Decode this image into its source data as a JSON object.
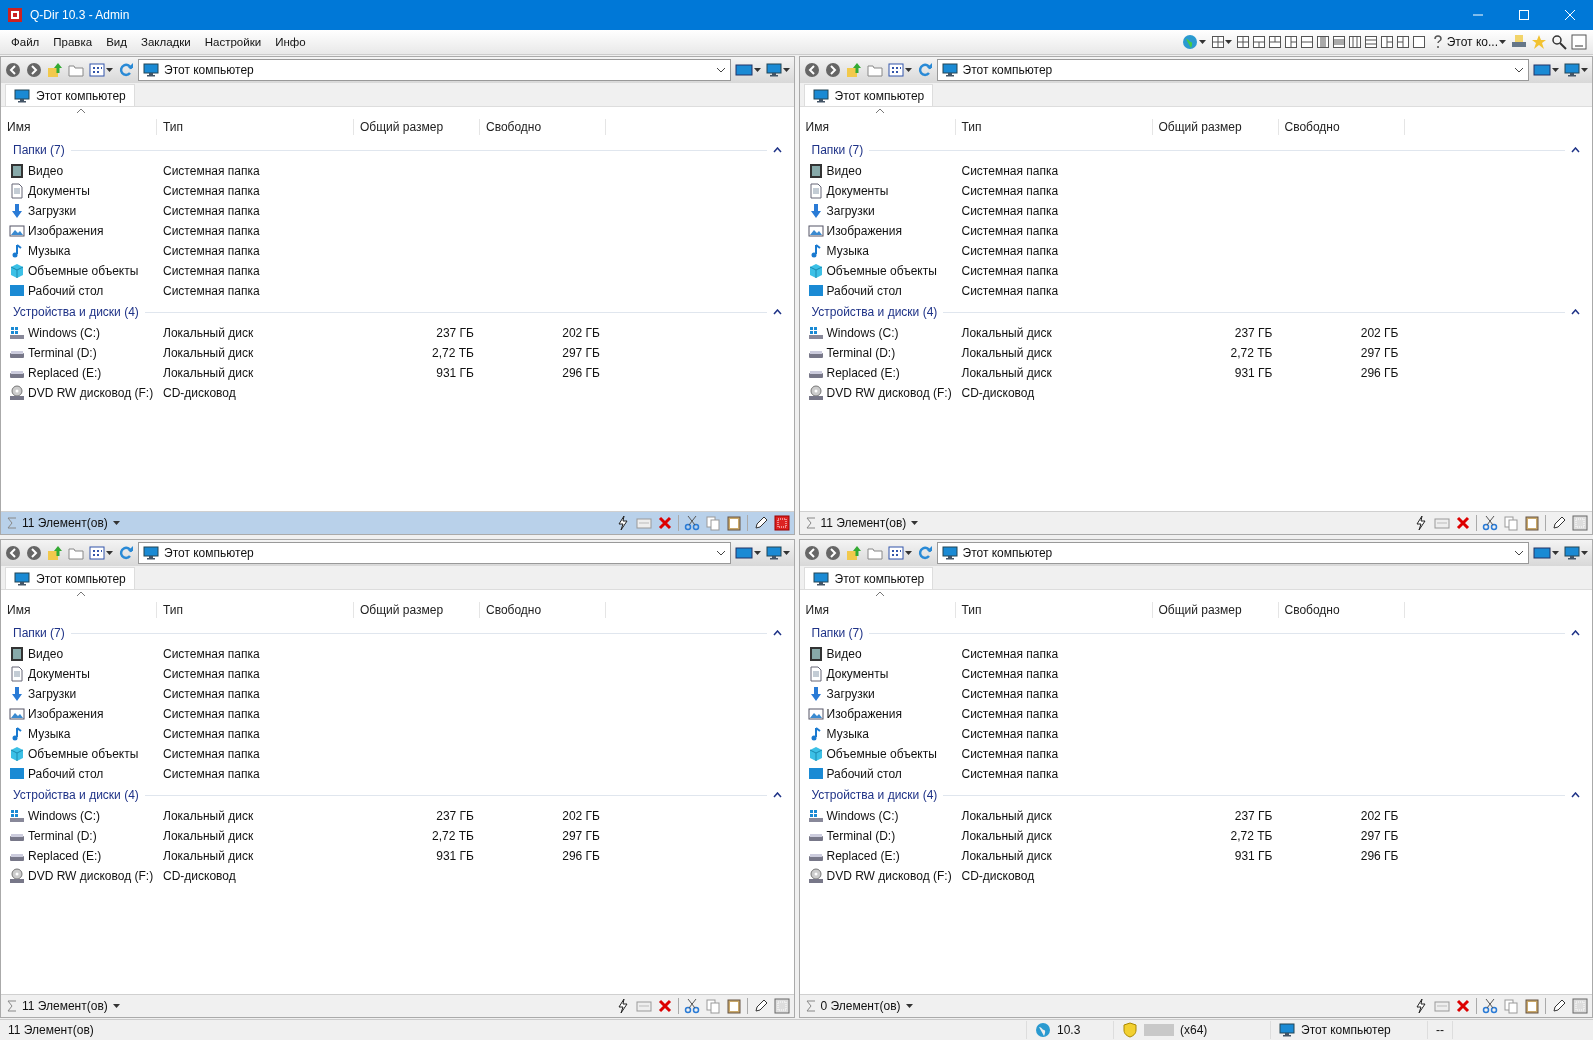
{
  "window": {
    "title": "Q-Dir 10.3 - Admin"
  },
  "menu": [
    "Файл",
    "Правка",
    "Вид",
    "Закладки",
    "Настройки",
    "Инфо"
  ],
  "toolbar": {
    "location": "Этот ко..."
  },
  "panes": [
    {
      "active": true,
      "address": "Этот компьютер",
      "tab": "Этот компьютер",
      "columns": [
        "Имя",
        "Тип",
        "Общий размер",
        "Свободно"
      ],
      "status": "11 Элемент(ов)",
      "groups": [
        {
          "title": "Папки (7)",
          "expanded": true,
          "items": [
            {
              "kind": "video",
              "name": "Видео",
              "type": "Системная папка"
            },
            {
              "kind": "documents",
              "name": "Документы",
              "type": "Системная папка"
            },
            {
              "kind": "downloads",
              "name": "Загрузки",
              "type": "Системная папка"
            },
            {
              "kind": "pictures",
              "name": "Изображения",
              "type": "Системная папка"
            },
            {
              "kind": "music",
              "name": "Музыка",
              "type": "Системная папка"
            },
            {
              "kind": "objects",
              "name": "Объемные объекты",
              "type": "Системная папка"
            },
            {
              "kind": "desktop",
              "name": "Рабочий стол",
              "type": "Системная папка"
            }
          ]
        },
        {
          "title": "Устройства и диски (4)",
          "expanded": true,
          "items": [
            {
              "kind": "system",
              "name": "Windows (C:)",
              "type": "Локальный диск",
              "total": "237 ГБ",
              "free": "202 ГБ"
            },
            {
              "kind": "drive",
              "name": "Terminal (D:)",
              "type": "Локальный диск",
              "total": "2,72 ТБ",
              "free": "297 ГБ"
            },
            {
              "kind": "drive",
              "name": "Replaced (E:)",
              "type": "Локальный диск",
              "total": "931 ГБ",
              "free": "296 ГБ"
            },
            {
              "kind": "dvd",
              "name": "DVD RW дисковод (F:)",
              "type": "CD-дисковод"
            }
          ]
        }
      ]
    },
    {
      "active": false,
      "address": "Этот компьютер",
      "tab": "Этот компьютер",
      "columns": [
        "Имя",
        "Тип",
        "Общий размер",
        "Свободно"
      ],
      "status": "11 Элемент(ов)",
      "groups": [
        {
          "title": "Папки (7)",
          "expanded": true,
          "items": [
            {
              "kind": "video",
              "name": "Видео",
              "type": "Системная папка"
            },
            {
              "kind": "documents",
              "name": "Документы",
              "type": "Системная папка"
            },
            {
              "kind": "downloads",
              "name": "Загрузки",
              "type": "Системная папка"
            },
            {
              "kind": "pictures",
              "name": "Изображения",
              "type": "Системная папка"
            },
            {
              "kind": "music",
              "name": "Музыка",
              "type": "Системная папка"
            },
            {
              "kind": "objects",
              "name": "Объемные объекты",
              "type": "Системная папка"
            },
            {
              "kind": "desktop",
              "name": "Рабочий стол",
              "type": "Системная папка"
            }
          ]
        },
        {
          "title": "Устройства и диски (4)",
          "expanded": true,
          "items": [
            {
              "kind": "system",
              "name": "Windows (C:)",
              "type": "Локальный диск",
              "total": "237 ГБ",
              "free": "202 ГБ"
            },
            {
              "kind": "drive",
              "name": "Terminal (D:)",
              "type": "Локальный диск",
              "total": "2,72 ТБ",
              "free": "297 ГБ"
            },
            {
              "kind": "drive",
              "name": "Replaced (E:)",
              "type": "Локальный диск",
              "total": "931 ГБ",
              "free": "296 ГБ"
            },
            {
              "kind": "dvd",
              "name": "DVD RW дисковод (F:)",
              "type": "CD-дисковод"
            }
          ]
        }
      ]
    },
    {
      "active": false,
      "address": "Этот компьютер",
      "tab": "Этот компьютер",
      "columns": [
        "Имя",
        "Тип",
        "Общий размер",
        "Свободно"
      ],
      "status": "11 Элемент(ов)",
      "groups": [
        {
          "title": "Папки (7)",
          "expanded": true,
          "items": [
            {
              "kind": "video",
              "name": "Видео",
              "type": "Системная папка"
            },
            {
              "kind": "documents",
              "name": "Документы",
              "type": "Системная папка"
            },
            {
              "kind": "downloads",
              "name": "Загрузки",
              "type": "Системная папка"
            },
            {
              "kind": "pictures",
              "name": "Изображения",
              "type": "Системная папка"
            },
            {
              "kind": "music",
              "name": "Музыка",
              "type": "Системная папка"
            },
            {
              "kind": "objects",
              "name": "Объемные объекты",
              "type": "Системная папка"
            },
            {
              "kind": "desktop",
              "name": "Рабочий стол",
              "type": "Системная папка"
            }
          ]
        },
        {
          "title": "Устройства и диски (4)",
          "expanded": true,
          "items": [
            {
              "kind": "system",
              "name": "Windows (C:)",
              "type": "Локальный диск",
              "total": "237 ГБ",
              "free": "202 ГБ"
            },
            {
              "kind": "drive",
              "name": "Terminal (D:)",
              "type": "Локальный диск",
              "total": "2,72 ТБ",
              "free": "297 ГБ"
            },
            {
              "kind": "drive",
              "name": "Replaced (E:)",
              "type": "Локальный диск",
              "total": "931 ГБ",
              "free": "296 ГБ"
            },
            {
              "kind": "dvd",
              "name": "DVD RW дисковод (F:)",
              "type": "CD-дисковод"
            }
          ]
        }
      ]
    },
    {
      "active": false,
      "address": "Этот компьютер",
      "tab": "Этот компьютер",
      "columns": [
        "Имя",
        "Тип",
        "Общий размер",
        "Свободно"
      ],
      "status": "0 Элемент(ов)",
      "groups": [
        {
          "title": "Папки (7)",
          "expanded": true,
          "items": [
            {
              "kind": "video",
              "name": "Видео",
              "type": "Системная папка"
            },
            {
              "kind": "documents",
              "name": "Документы",
              "type": "Системная папка"
            },
            {
              "kind": "downloads",
              "name": "Загрузки",
              "type": "Системная папка"
            },
            {
              "kind": "pictures",
              "name": "Изображения",
              "type": "Системная папка"
            },
            {
              "kind": "music",
              "name": "Музыка",
              "type": "Системная папка"
            },
            {
              "kind": "objects",
              "name": "Объемные объекты",
              "type": "Системная папка"
            },
            {
              "kind": "desktop",
              "name": "Рабочий стол",
              "type": "Системная папка"
            }
          ]
        },
        {
          "title": "Устройства и диски (4)",
          "expanded": true,
          "items": [
            {
              "kind": "system",
              "name": "Windows (C:)",
              "type": "Локальный диск",
              "total": "237 ГБ",
              "free": "202 ГБ"
            },
            {
              "kind": "drive",
              "name": "Terminal (D:)",
              "type": "Локальный диск",
              "total": "2,72 ТБ",
              "free": "297 ГБ"
            },
            {
              "kind": "drive",
              "name": "Replaced (E:)",
              "type": "Локальный диск",
              "total": "931 ГБ",
              "free": "296 ГБ"
            },
            {
              "kind": "dvd",
              "name": "DVD RW дисковод (F:)",
              "type": "CD-дисковод"
            }
          ]
        }
      ]
    }
  ],
  "status_bar": {
    "items": "11 Элемент(ов)",
    "version": "10.3",
    "arch": "(x64)",
    "location": "Этот компьютер",
    "extra": "--"
  }
}
